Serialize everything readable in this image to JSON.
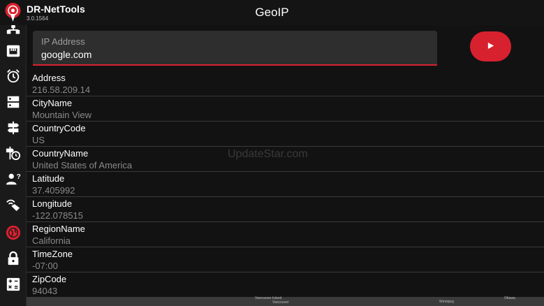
{
  "app": {
    "name": "DR-NetTools",
    "version": "3.0.1564"
  },
  "page": {
    "title": "GeoIP"
  },
  "input": {
    "label": "IP Address",
    "value": "google.com"
  },
  "colors": {
    "accent": "#d8212f",
    "background": "#121212"
  },
  "sidebar": {
    "items": [
      {
        "icon": "network-nodes-icon"
      },
      {
        "icon": "ethernet-icon"
      },
      {
        "icon": "alarm-clock-icon"
      },
      {
        "icon": "server-icon"
      },
      {
        "icon": "signpost-icon"
      },
      {
        "icon": "signpost-clock-icon"
      },
      {
        "icon": "user-question-icon"
      },
      {
        "icon": "wifi-hand-icon"
      },
      {
        "icon": "globe-icon",
        "active": true
      },
      {
        "icon": "lock-icon"
      },
      {
        "icon": "calculator-icon"
      }
    ]
  },
  "results": [
    {
      "key": "Address",
      "value": "216.58.209.14"
    },
    {
      "key": "CityName",
      "value": "Mountain View"
    },
    {
      "key": "CountryCode",
      "value": "US"
    },
    {
      "key": "CountryName",
      "value": "United States of America"
    },
    {
      "key": "Latitude",
      "value": "37.405992"
    },
    {
      "key": "Longitude",
      "value": "-122.078515"
    },
    {
      "key": "RegionName",
      "value": "California"
    },
    {
      "key": "TimeZone",
      "value": "-07:00"
    },
    {
      "key": "ZipCode",
      "value": "94043"
    }
  ],
  "watermark": "UpdateStar.com",
  "map": {
    "labels": [
      "Vancouver Island",
      "Vancouver",
      "Winnipeg",
      "Ottawa"
    ]
  }
}
